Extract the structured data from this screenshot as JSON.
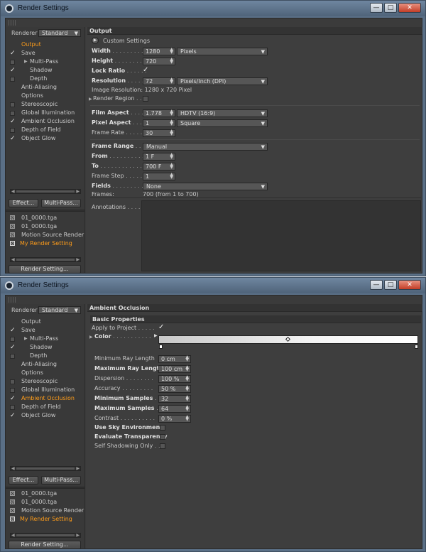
{
  "window_title": "Render Settings",
  "window_buttons": {
    "minimize": "—",
    "maximize": "□",
    "close": "✕"
  },
  "renderer": {
    "label": "Renderer",
    "value": "Standard"
  },
  "tree_items": [
    {
      "label": "Output",
      "checked": "none"
    },
    {
      "label": "Save",
      "checked": "checked"
    },
    {
      "label": "Multi-Pass",
      "checked": "unchecked"
    },
    {
      "label": "Shadow",
      "checked": "checked"
    },
    {
      "label": "Depth",
      "checked": "unchecked"
    },
    {
      "label": "Anti-Aliasing",
      "checked": "none"
    },
    {
      "label": "Options",
      "checked": "none"
    },
    {
      "label": "Stereoscopic",
      "checked": "unchecked"
    },
    {
      "label": "Global Illumination",
      "checked": "unchecked"
    },
    {
      "label": "Ambient Occlusion",
      "checked": "checked"
    },
    {
      "label": "Depth of Field",
      "checked": "unchecked"
    },
    {
      "label": "Object Glow",
      "checked": "checked"
    }
  ],
  "buttons": {
    "effect": "Effect...",
    "multipass": "Multi-Pass...",
    "render_setting": "Render Setting..."
  },
  "settings_list": [
    "01_0000.tga",
    "01_0000.tga",
    "Motion Source Render",
    "My Render Setting"
  ],
  "output": {
    "section_title": "Output",
    "custom_settings": "Custom Settings",
    "width_label": "Width",
    "width_value": "1280",
    "width_unit": "Pixels",
    "height_label": "Height",
    "height_value": "720",
    "lock_ratio_label": "Lock Ratio",
    "resolution_label": "Resolution",
    "resolution_value": "72",
    "resolution_unit": "Pixels/Inch (DPI)",
    "image_resolution": "Image Resolution: 1280 x 720 Pixel",
    "render_region_label": "Render Region",
    "film_aspect_label": "Film Aspect",
    "film_aspect_value": "1.778",
    "film_aspect_preset": "HDTV (16:9)",
    "pixel_aspect_label": "Pixel Aspect",
    "pixel_aspect_value": "1",
    "pixel_aspect_preset": "Square",
    "frame_rate_label": "Frame Rate",
    "frame_rate_value": "30",
    "frame_range_label": "Frame Range",
    "frame_range_value": "Manual",
    "from_label": "From",
    "from_value": "1 F",
    "to_label": "To",
    "to_value": "700 F",
    "frame_step_label": "Frame Step",
    "frame_step_value": "1",
    "fields_label": "Fields",
    "fields_value": "None",
    "frames_label": "Frames:",
    "frames_value": "700 (from 1 to 700)",
    "annotations_label": "Annotations"
  },
  "ao": {
    "section_title": "Ambient Occlusion",
    "basic_properties": "Basic Properties",
    "apply_label": "Apply to Project",
    "color_label": "Color",
    "min_ray_label": "Minimum Ray Length",
    "min_ray_value": "0 cm",
    "max_ray_label": "Maximum Ray Length",
    "max_ray_value": "100 cm",
    "dispersion_label": "Dispersion",
    "dispersion_value": "100 %",
    "accuracy_label": "Accuracy",
    "accuracy_value": "50 %",
    "min_samples_label": "Minimum Samples",
    "min_samples_value": "32",
    "max_samples_label": "Maximum Samples",
    "max_samples_value": "64",
    "contrast_label": "Contrast",
    "contrast_value": "0 %",
    "sky_label": "Use Sky Environment",
    "transparency_label": "Evaluate Transparency",
    "self_shadow_label": "Self Shadowing Only"
  },
  "colors": {
    "selected": "#ff9d1a",
    "panel": "#3b3b3b",
    "titlebar": "#5a6f86"
  }
}
